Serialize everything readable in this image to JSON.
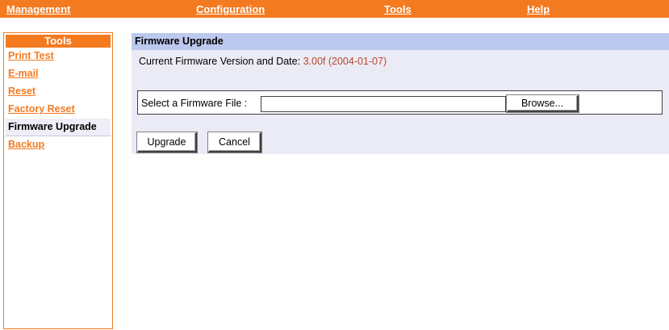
{
  "topnav": {
    "items": [
      {
        "label": "Management"
      },
      {
        "label": "Configuration"
      },
      {
        "label": "Tools"
      },
      {
        "label": "Help"
      }
    ]
  },
  "sidebar": {
    "title": "Tools",
    "items": [
      {
        "label": "Print Test"
      },
      {
        "label": "E-mail"
      },
      {
        "label": "Reset"
      },
      {
        "label": "Factory Reset"
      },
      {
        "label": "Firmware Upgrade"
      },
      {
        "label": "Backup"
      }
    ],
    "active_item": "Firmware Upgrade"
  },
  "panel": {
    "title": "Firmware Upgrade",
    "version_label": "Current Firmware Version and Date:",
    "version_value": "3.00f (2004-01-07)",
    "file_label": "Select a Firmware File :",
    "file_value": "",
    "browse_label": "Browse...",
    "upgrade_label": "Upgrade",
    "cancel_label": "Cancel"
  },
  "colors": {
    "accent": "#f47a20",
    "panel_header": "#bcc8ee",
    "panel_bg": "#ebebf5",
    "version_value": "#b8462c"
  }
}
